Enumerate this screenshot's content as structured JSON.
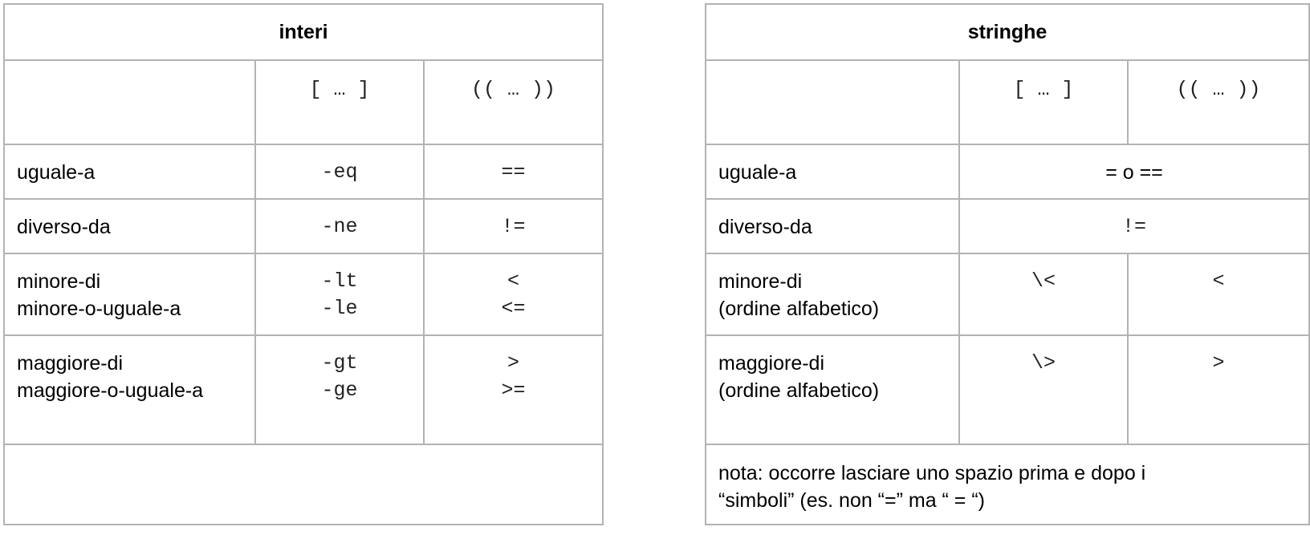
{
  "interi": {
    "title": "interi",
    "col_brackets": "[ … ]",
    "col_parens": "(( … ))",
    "rows": [
      {
        "label": [
          "uguale-a"
        ],
        "brackets": [
          "-eq"
        ],
        "parens": [
          "=="
        ]
      },
      {
        "label": [
          "diverso-da"
        ],
        "brackets": [
          "-ne"
        ],
        "parens": [
          "!="
        ]
      },
      {
        "label": [
          "minore-di",
          "minore-o-uguale-a"
        ],
        "brackets": [
          "-lt",
          "-le"
        ],
        "parens": [
          "<",
          "<="
        ]
      },
      {
        "label": [
          "maggiore-di",
          "maggiore-o-uguale-a"
        ],
        "brackets": [
          "-gt",
          "-ge"
        ],
        "parens": [
          ">",
          ">="
        ]
      }
    ],
    "note": ""
  },
  "stringhe": {
    "title": "stringhe",
    "col_brackets": "[ … ]",
    "col_parens": "(( … ))",
    "rows": [
      {
        "label": [
          "uguale-a"
        ],
        "merged": "= o =="
      },
      {
        "label": [
          "diverso-da"
        ],
        "merged": "!="
      },
      {
        "label": [
          "minore-di",
          "(ordine alfabetico)"
        ],
        "brackets": [
          "\\<"
        ],
        "parens": [
          "<"
        ]
      },
      {
        "label": [
          "maggiore-di",
          "(ordine alfabetico)"
        ],
        "brackets": [
          "\\>"
        ],
        "parens": [
          ">"
        ]
      }
    ],
    "note": [
      "nota: occorre lasciare uno spazio prima e dopo i",
      "“simboli” (es. non “=” ma “  =  “)"
    ]
  }
}
